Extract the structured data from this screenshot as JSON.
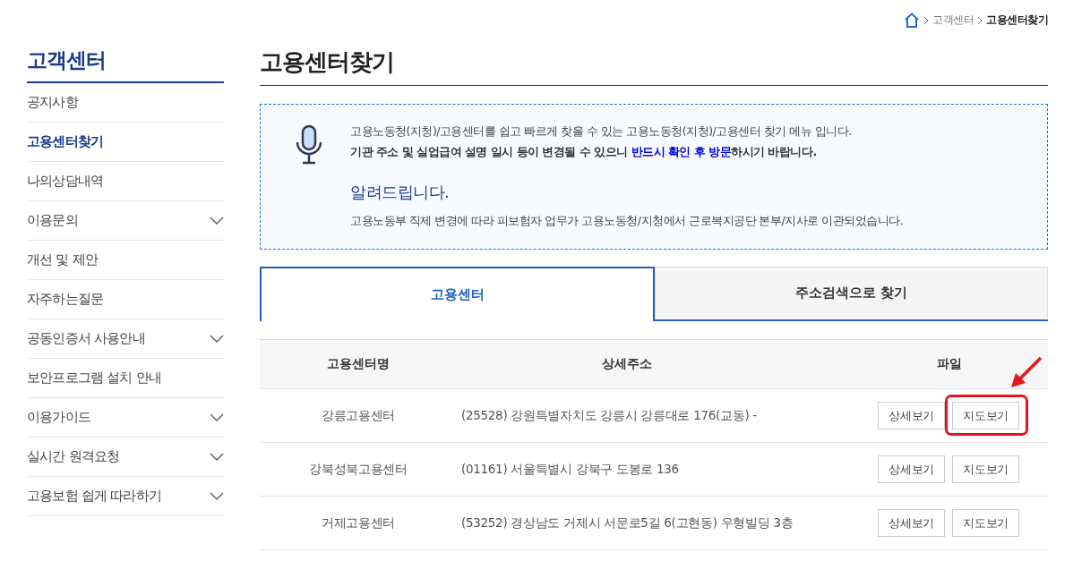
{
  "breadcrumb": [
    "고객센터",
    "고용센터찾기"
  ],
  "sidebar": {
    "title": "고객센터",
    "items": [
      {
        "label": "공지사항",
        "selected": false,
        "expandable": false
      },
      {
        "label": "고용센터찾기",
        "selected": true,
        "expandable": false
      },
      {
        "label": "나의상담내역",
        "selected": false,
        "expandable": false
      },
      {
        "label": "이용문의",
        "selected": false,
        "expandable": true
      },
      {
        "label": "개선 및 제안",
        "selected": false,
        "expandable": false
      },
      {
        "label": "자주하는질문",
        "selected": false,
        "expandable": false
      },
      {
        "label": "공동인증서 사용안내",
        "selected": false,
        "expandable": true
      },
      {
        "label": "보안프로그램 설치 안내",
        "selected": false,
        "expandable": false
      },
      {
        "label": "이용가이드",
        "selected": false,
        "expandable": true
      },
      {
        "label": "실시간 원격요청",
        "selected": false,
        "expandable": true
      },
      {
        "label": "고용보험 쉽게 따라하기",
        "selected": false,
        "expandable": true
      }
    ]
  },
  "page_title": "고용센터찾기",
  "notice": {
    "line1": "고용노동청(지청)/고용센터를 쉽고 빠르게 찾을 수 있는 고용노동청(지청)/고용센터 찾기 메뉴 입니다.",
    "line2": [
      {
        "text": "기관 주소 및 실업급여 설명 일시 등이 변경될 수 있으니 ",
        "emphasis": false
      },
      {
        "text": "반드시 확인 후 방문",
        "emphasis": true
      },
      {
        "text": "하시기 바랍니다.",
        "emphasis": false
      }
    ],
    "heading": "알려드립니다.",
    "body": "고용노동부 직제 변경에 따라 피보험자 업무가 고용노동청/지청에서 근로복지공단 본부/지사로 이관되었습니다."
  },
  "tabs": [
    {
      "label": "고용센터",
      "selected": true
    },
    {
      "label": "주소검색으로 찾기",
      "selected": false
    }
  ],
  "table": {
    "columns": [
      "고용센터명",
      "상세주소",
      "파일"
    ],
    "rows": [
      {
        "name": "강릉고용센터",
        "address": "(25528) 강원특별자치도 강릉시 강릉대로 176(교동) -",
        "buttons": [
          "상세보기",
          "지도보기"
        ],
        "highlighted": true
      },
      {
        "name": "강북성북고용센터",
        "address": "(01161) 서울특별시 강북구 도봉로 136",
        "buttons": [
          "상세보기",
          "지도보기"
        ],
        "highlighted": false
      },
      {
        "name": "거제고용센터",
        "address": "(53252) 경상남도 거제시 서문로5길 6(고현동) 우형빌딩 3층",
        "buttons": [
          "상세보기",
          "지도보기"
        ],
        "highlighted": false
      }
    ]
  }
}
